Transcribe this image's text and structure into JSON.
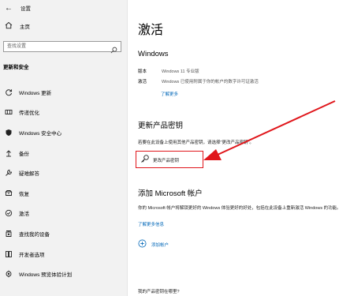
{
  "titlebar": {
    "back_glyph": "←",
    "title": "设置"
  },
  "home": {
    "label": "主页"
  },
  "search": {
    "placeholder": "查找设置"
  },
  "sidebar": {
    "section": "更新和安全",
    "items": [
      {
        "label": "Windows 更新",
        "icon": "refresh-icon"
      },
      {
        "label": "传递优化",
        "icon": "delivery-optimization-icon"
      },
      {
        "label": "Windows 安全中心",
        "icon": "shield-icon"
      },
      {
        "label": "备份",
        "icon": "backup-icon"
      },
      {
        "label": "疑难解答",
        "icon": "wrench-icon"
      },
      {
        "label": "恢复",
        "icon": "recovery-icon"
      },
      {
        "label": "激活",
        "icon": "activation-icon"
      },
      {
        "label": "查找我的设备",
        "icon": "find-device-icon"
      },
      {
        "label": "开发者选项",
        "icon": "developer-icon"
      },
      {
        "label": "Windows 预览体验计划",
        "icon": "insider-icon"
      }
    ]
  },
  "main": {
    "title": "激活",
    "windows_heading": "Windows",
    "edition_label": "版本",
    "edition_value": "Windows 11 专业版",
    "activation_label": "激活",
    "activation_value": "Windows 已使用附属于你的帐户的数字许可证激活",
    "learn_more": "了解更多",
    "change_key_heading": "更新产品密钥",
    "change_key_desc": "若要在此设备上使用其他产品密钥，请选择\"更改产品密钥\"。",
    "change_key_button": "更改产品密钥",
    "ms_account_heading": "添加 Microsoft 帐户",
    "ms_account_desc": "你的 Microsoft 帐户将解锁更好的 Windows 体验更好的好处，包括在此设备上重新激活 Windows 的功能。",
    "ms_learn_more": "了解更多信息",
    "add_account": "添加帐户",
    "where_key": "我的产品密钥在哪里?"
  },
  "colors": {
    "accent": "#0067b8",
    "annotation": "#e0161b",
    "sidebar_bg": "#f2f2f2"
  }
}
